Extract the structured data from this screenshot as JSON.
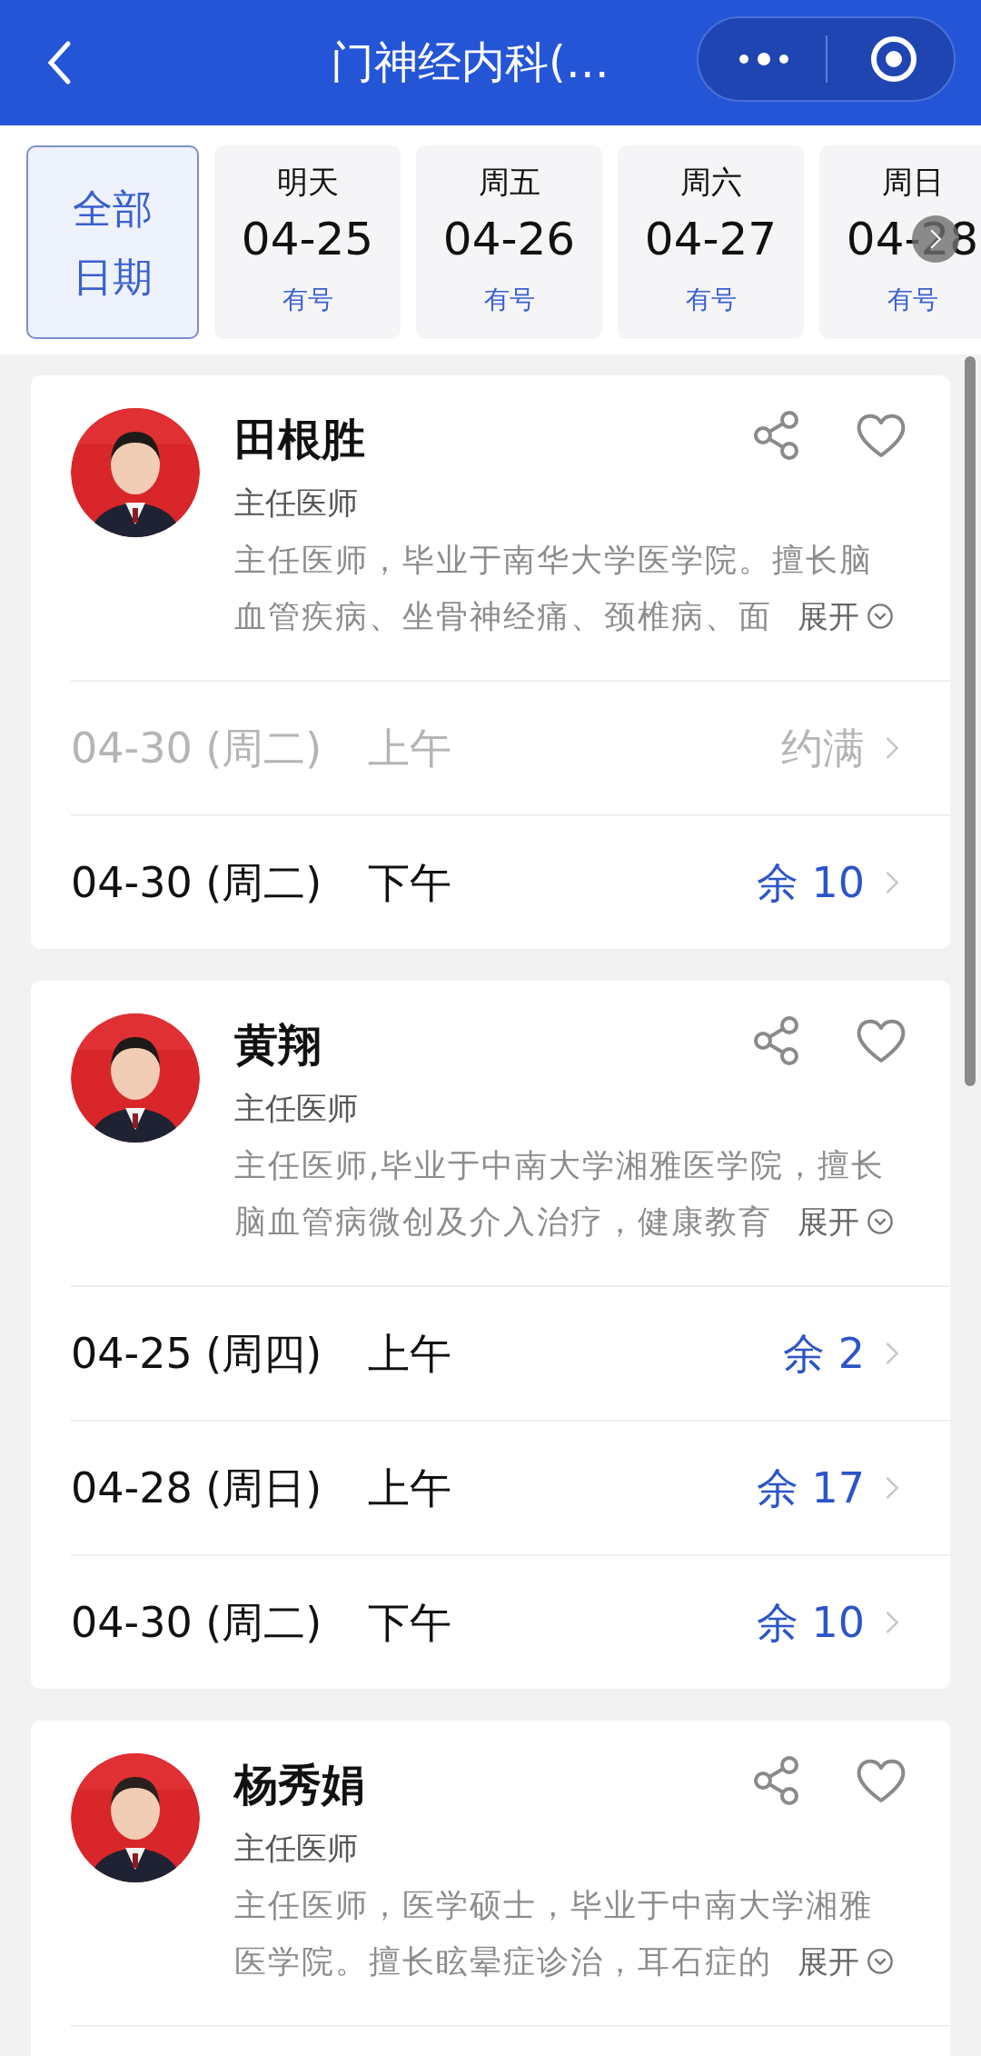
{
  "header": {
    "title": "门神经内科(…"
  },
  "date_tabs": [
    {
      "kind": "all",
      "label": "全部日期",
      "selected": true
    },
    {
      "kind": "day",
      "label": "明天",
      "date": "04-25",
      "availability": "有号",
      "selected": false
    },
    {
      "kind": "day",
      "label": "周五",
      "date": "04-26",
      "availability": "有号",
      "selected": false
    },
    {
      "kind": "day",
      "label": "周六",
      "date": "04-27",
      "availability": "有号",
      "selected": false
    },
    {
      "kind": "day",
      "label": "周日",
      "date": "04-28",
      "availability": "有号",
      "selected": false
    }
  ],
  "doctors": [
    {
      "name": "田根胜",
      "title": "主任医师",
      "bio_lines": [
        "主任医师，毕业于南华大学医学院。擅长脑",
        "血管疾病、坐骨神经痛、颈椎病、面"
      ],
      "expand": "展开",
      "favorite": false,
      "slots": [
        {
          "date": "04-30 (周二)",
          "period": "上午",
          "status": "约满",
          "available": false
        },
        {
          "date": "04-30 (周二)",
          "period": "下午",
          "status": "余 10",
          "available": true
        }
      ]
    },
    {
      "name": "黄翔",
      "title": "主任医师",
      "bio_lines": [
        "主任医师,毕业于中南大学湘雅医学院，擅长",
        "脑血管病微创及介入治疗，健康教育"
      ],
      "expand": "展开",
      "favorite": false,
      "slots": [
        {
          "date": "04-25 (周四)",
          "period": "上午",
          "status": "余 2",
          "available": true
        },
        {
          "date": "04-28 (周日)",
          "period": "上午",
          "status": "余 17",
          "available": true
        },
        {
          "date": "04-30 (周二)",
          "period": "下午",
          "status": "余 10",
          "available": true
        }
      ]
    },
    {
      "name": "杨秀娟",
      "title": "主任医师",
      "bio_lines": [
        "主任医师，医学硕士，毕业于中南大学湘雅",
        "医学院。擅长眩晕症诊治，耳石症的"
      ],
      "expand": "展开",
      "favorite": false
    }
  ]
}
